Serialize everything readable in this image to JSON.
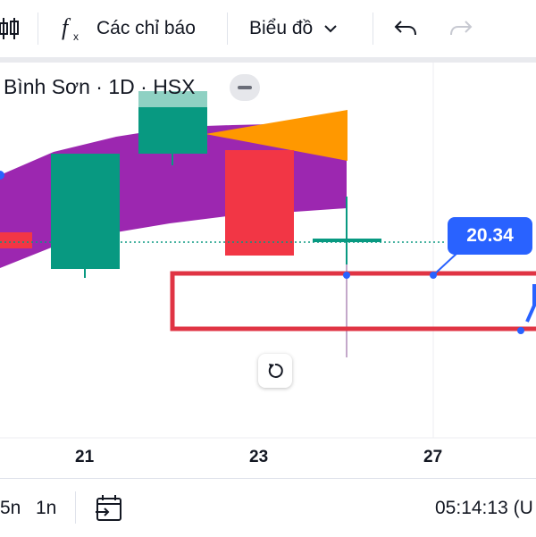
{
  "toolbar": {
    "indicators_label": "Các chỉ báo",
    "chart_type_label": "Biểu đồ"
  },
  "legend": {
    "symbol_text": "Bình Sơn · 1D · HSX"
  },
  "price_tag": "20.34",
  "x_axis": {
    "ticks": [
      "21",
      "23",
      "27"
    ]
  },
  "bottom_bar": {
    "range_5n": "5n",
    "range_1n": "1n",
    "clock": "05:14:13 (U"
  },
  "colors": {
    "up": "#089981",
    "down": "#f23645",
    "band": "#9c27b0",
    "triangle": "#ff9800",
    "accent": "#2962ff"
  }
}
